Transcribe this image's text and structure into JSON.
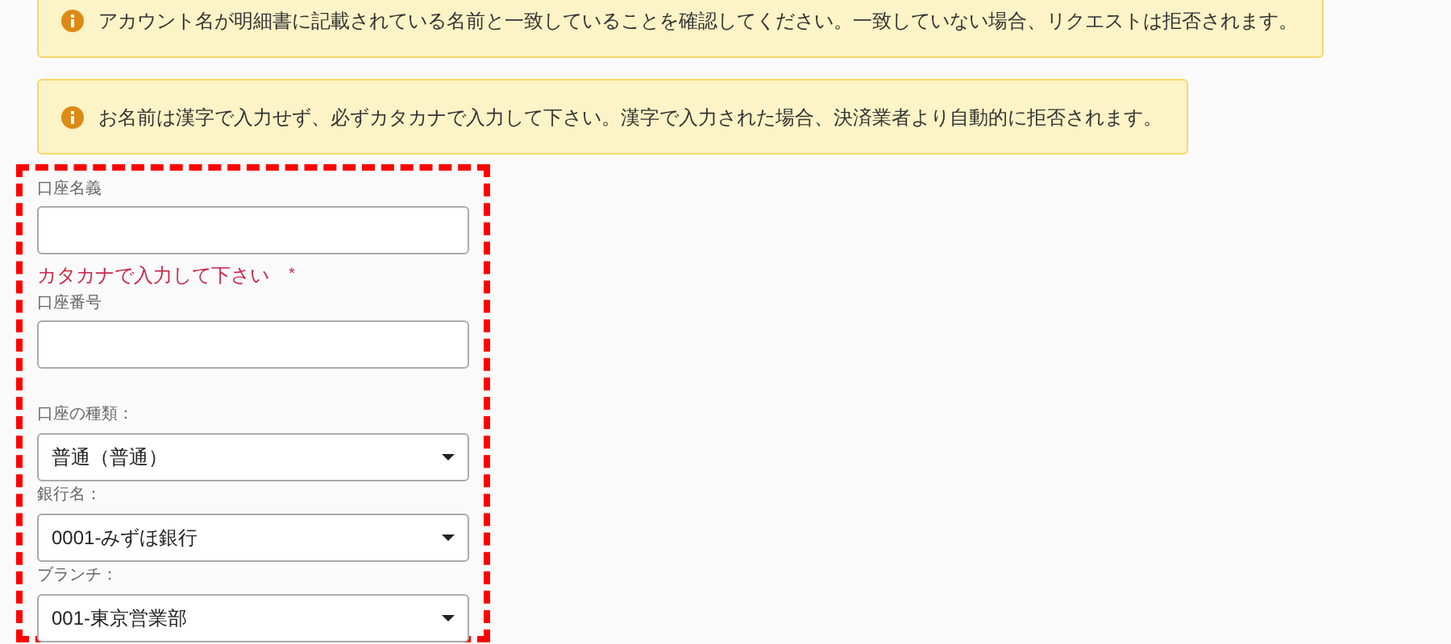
{
  "alerts": [
    {
      "text": "アカウント名が明細書に記載されている名前と一致していることを確認してください。一致していない場合、リクエストは拒否されます。"
    },
    {
      "text": "お名前は漢字で入力せず、必ずカタカナで入力して下さい。漢字で入力された場合、決済業者より自動的に拒否されます。"
    }
  ],
  "fields": [
    {
      "kind": "text",
      "label": "口座名義",
      "hint": "カタカナで入力して下さい",
      "required_mark": "*"
    },
    {
      "kind": "text",
      "label": "口座番号"
    },
    {
      "kind": "select",
      "label": "口座の種類：",
      "value": "普通（普通）"
    },
    {
      "kind": "select",
      "label": "銀行名：",
      "value": "0001-みずほ銀行"
    },
    {
      "kind": "select",
      "label": "ブランチ：",
      "value": "001-東京営業部"
    }
  ]
}
